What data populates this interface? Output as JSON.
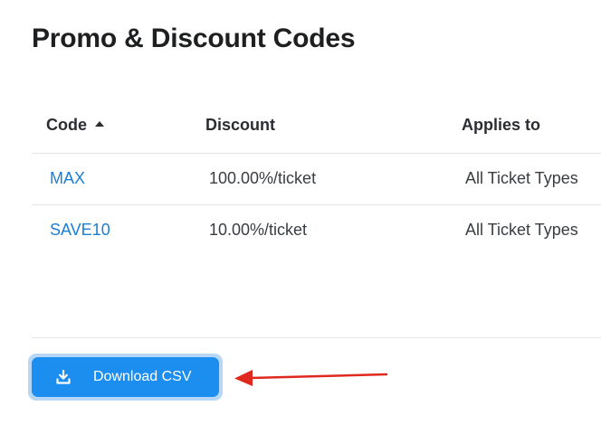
{
  "page": {
    "title": "Promo & Discount Codes"
  },
  "table": {
    "columns": [
      {
        "label": "Code",
        "sorted": "ascending"
      },
      {
        "label": "Discount"
      },
      {
        "label": "Applies to"
      }
    ],
    "rows": [
      {
        "code": "MAX",
        "discount": "100.00%/ticket",
        "applies_to": "All Ticket Types"
      },
      {
        "code": "SAVE10",
        "discount": "10.00%/ticket",
        "applies_to": "All Ticket Types"
      }
    ]
  },
  "footer": {
    "download_label": "Download CSV",
    "download_icon": "download-icon"
  },
  "annotation": {
    "arrow_color": "#e0281e",
    "points_to": "download-button"
  },
  "colors": {
    "accent": "#1b8ef0",
    "link": "#1a7fd6"
  }
}
